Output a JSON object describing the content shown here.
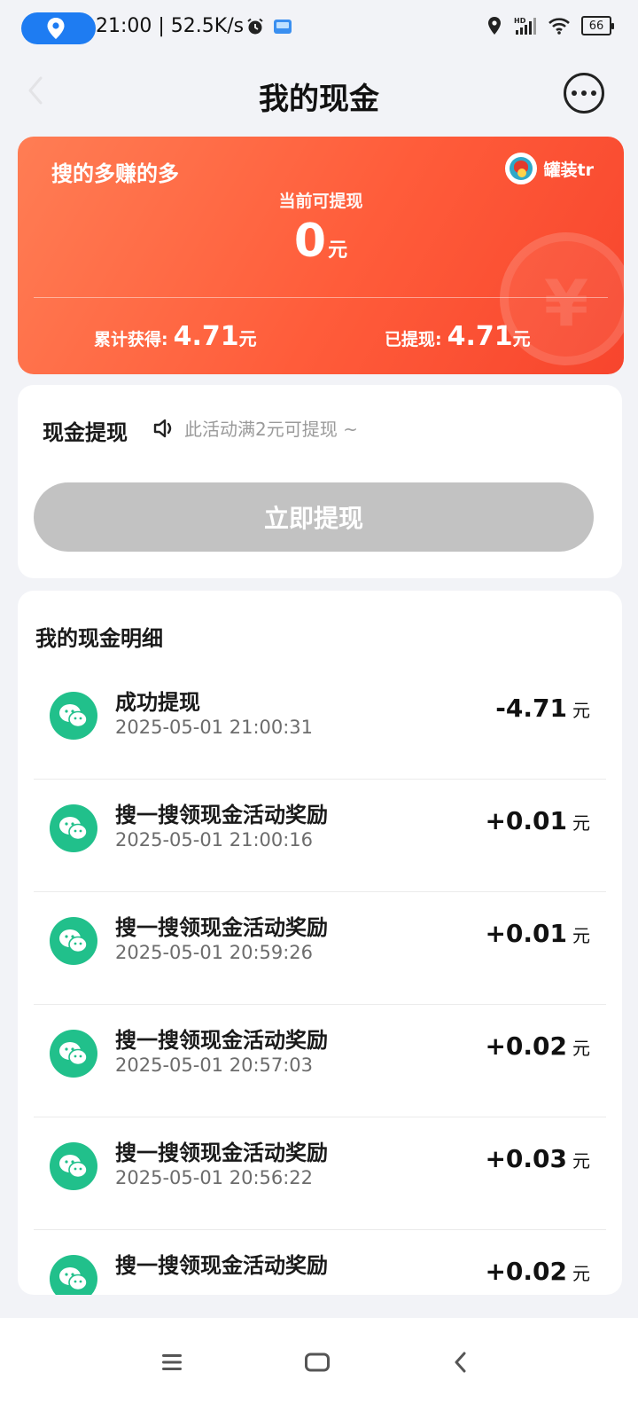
{
  "status_bar": {
    "time_speed": "21:00 | 52.5K/s",
    "battery": "66"
  },
  "header": {
    "title": "我的现金"
  },
  "balance_card": {
    "slogan": "搜的多赚的多",
    "user_name": "罐装tr",
    "available_label": "当前可提现",
    "available_value": "0",
    "available_unit": "元",
    "earned_label": "累计获得:",
    "earned_value": "4.71",
    "earned_unit": "元",
    "withdrawn_label": "已提现:",
    "withdrawn_value": "4.71",
    "withdrawn_unit": "元",
    "coin_symbol": "¥"
  },
  "withdraw": {
    "title": "现金提现",
    "notice": "此活动满2元可提现 ~",
    "button_label": "立即提现"
  },
  "details": {
    "title": "我的现金明细",
    "unit": "元",
    "rows": [
      {
        "title": "成功提现",
        "time": "2025-05-01 21:00:31",
        "amount": "-4.71"
      },
      {
        "title": "搜一搜领现金活动奖励",
        "time": "2025-05-01 21:00:16",
        "amount": "+0.01"
      },
      {
        "title": "搜一搜领现金活动奖励",
        "time": "2025-05-01 20:59:26",
        "amount": "+0.01"
      },
      {
        "title": "搜一搜领现金活动奖励",
        "time": "2025-05-01 20:57:03",
        "amount": "+0.02"
      },
      {
        "title": "搜一搜领现金活动奖励",
        "time": "2025-05-01 20:56:22",
        "amount": "+0.03"
      },
      {
        "title": "搜一搜领现金活动奖励",
        "time": "",
        "amount": "+0.02"
      }
    ]
  },
  "colors": {
    "card_gradient_start": "#ff7d54",
    "card_gradient_end": "#f7452d",
    "wechat_green": "#21c08b",
    "button_disabled": "#c2c2c2",
    "status_pill": "#1e7cf2"
  }
}
